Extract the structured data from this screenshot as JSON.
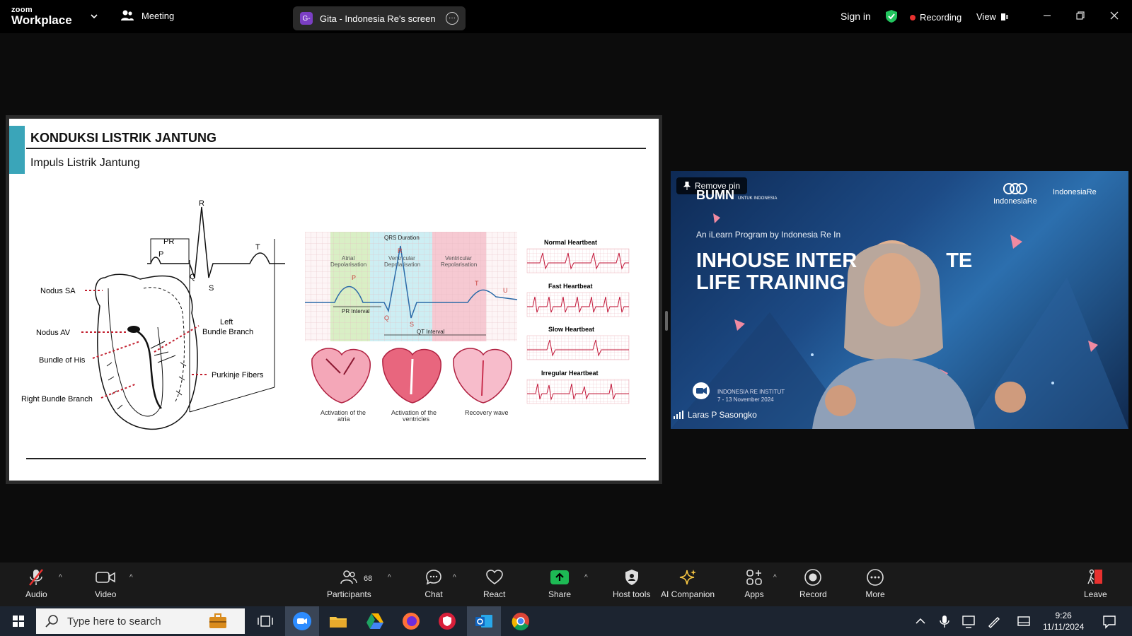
{
  "topbar": {
    "logo_top": "zoom",
    "logo_bottom": "Workplace",
    "meeting_label": "Meeting",
    "share_badge": "G-",
    "share_title": "Gita - Indonesia Re's screen",
    "signin": "Sign in",
    "recording": "Recording",
    "view": "View"
  },
  "slide": {
    "title": "KONDUKSI LISTRIK JANTUNG",
    "subtitle": "Impuls Listrik Jantung",
    "heart_labels": {
      "nodus_sa": "Nodus SA",
      "nodus_av": "Nodus AV",
      "bundle_his": "Bundle of His",
      "right_bundle": "Right Bundle Branch",
      "left_bundle_1": "Left",
      "left_bundle_2": "Bundle Branch",
      "purkinje": "Purkinje Fibers"
    },
    "ecg_letters": {
      "p": "P",
      "pr": "PR",
      "q": "Q",
      "r": "R",
      "s": "S",
      "t": "T"
    },
    "wave_labels": {
      "qrs": "QRS Duration",
      "atrial_1": "Atrial",
      "atrial_2": "Depolarisation",
      "vent_dep_1": "Ventricular",
      "vent_dep_2": "Depolarisation",
      "vent_rep_1": "Ventricular",
      "vent_rep_2": "Repolarisation",
      "pr_interval": "PR Interval",
      "qt_interval": "QT Interval",
      "p": "P",
      "q": "Q",
      "r": "R",
      "s": "S",
      "t": "T",
      "u": "U"
    },
    "activation": {
      "a1_1": "Activation of the",
      "a1_2": "atria",
      "a2_1": "Activation of the",
      "a2_2": "ventricles",
      "a3": "Recovery wave"
    },
    "heartbeats": {
      "normal": "Normal Heartbeat",
      "fast": "Fast Heartbeat",
      "slow": "Slow Heartbeat",
      "irregular": "Irregular Heartbeat"
    }
  },
  "video": {
    "remove_pin": "Remove pin",
    "bumn": "BUMN",
    "bumn_sub": "UNTUK INDONESIA",
    "brand1": "IndonesiaRe",
    "brand2": "IndonesiaRe",
    "program": "An iLearn Program by Indonesia Re In",
    "headline_1": "INHOUSE INTER",
    "headline_1b": "TE",
    "headline_2": "LIFE TRAINING",
    "event_1": "INDONESIA RE INSTITUT",
    "event_2": "7 - 13 November 2024",
    "participant_name": "Laras P Sasongko"
  },
  "toolbar": {
    "audio": "Audio",
    "video": "Video",
    "participants": "Participants",
    "participants_count": "68",
    "chat": "Chat",
    "react": "React",
    "share": "Share",
    "host_tools": "Host tools",
    "ai_companion": "AI Companion",
    "apps": "Apps",
    "record": "Record",
    "more": "More",
    "leave": "Leave"
  },
  "taskbar": {
    "search_placeholder": "Type here to search",
    "time": "9:26",
    "date": "11/11/2024"
  },
  "colors": {
    "accent_teal": "#3aa5b9",
    "recording_red": "#e8312f",
    "share_green": "#1db954",
    "shield_green": "#22c55e",
    "leave_red": "#e8312f",
    "ai_gold": "#f5c542"
  }
}
